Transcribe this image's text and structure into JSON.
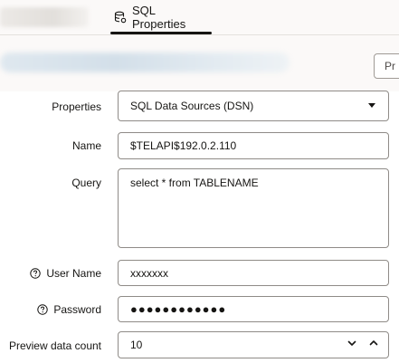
{
  "tabs": {
    "active_label": "SQL Properties"
  },
  "toolbar": {
    "preview_label": "Pr"
  },
  "form": {
    "properties": {
      "label": "Properties",
      "value": "SQL Data Sources (DSN)"
    },
    "name": {
      "label": "Name",
      "value": "$TELAPI$192.0.2.110"
    },
    "query": {
      "label": "Query",
      "value": "select * from TABLENAME"
    },
    "user_name": {
      "label": "User Name",
      "value": "xxxxxxx"
    },
    "password": {
      "label": "Password",
      "value": "●●●●●●●●●●●●"
    },
    "preview_count": {
      "label": "Preview data count",
      "value": "10"
    }
  },
  "icons": {
    "tab": "database-settings-icon",
    "help": "question-circle-icon",
    "dropdown": "caret-down-icon",
    "decrement": "chevron-down-icon",
    "increment": "chevron-up-icon"
  }
}
